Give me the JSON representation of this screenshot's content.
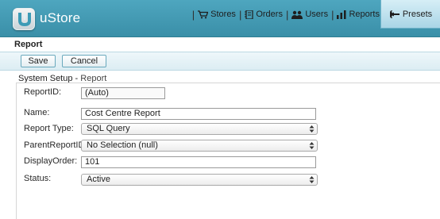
{
  "app": {
    "name": "uStore"
  },
  "nav": {
    "items": [
      {
        "label": "Stores",
        "icon": "cart-icon"
      },
      {
        "label": "Orders",
        "icon": "orders-icon"
      },
      {
        "label": "Users",
        "icon": "users-icon"
      },
      {
        "label": "Reports",
        "icon": "bar-chart-icon"
      }
    ],
    "active": {
      "label": "Presets",
      "icon": "wrench-icon"
    }
  },
  "page": {
    "title": "Report"
  },
  "toolbar": {
    "save_label": "Save",
    "cancel_label": "Cancel"
  },
  "section": {
    "title": "System Setup - ",
    "subtitle": "Report"
  },
  "form": {
    "report_id": {
      "label": "ReportID:",
      "value": "(Auto)"
    },
    "name": {
      "label": "Name:",
      "value": "Cost Centre Report"
    },
    "report_type": {
      "label": "Report Type:",
      "value": "SQL Query"
    },
    "parent_report_id": {
      "label": "ParentReportID:",
      "value": "No Selection (null)"
    },
    "display_order": {
      "label": "DisplayOrder:",
      "value": "101"
    },
    "status": {
      "label": "Status:",
      "value": "Active"
    }
  },
  "colors": {
    "header_bg": "#4ea6bf",
    "active_tab_bg": "#bfe2ee",
    "toolbar_bg": "#e6f2f6"
  }
}
